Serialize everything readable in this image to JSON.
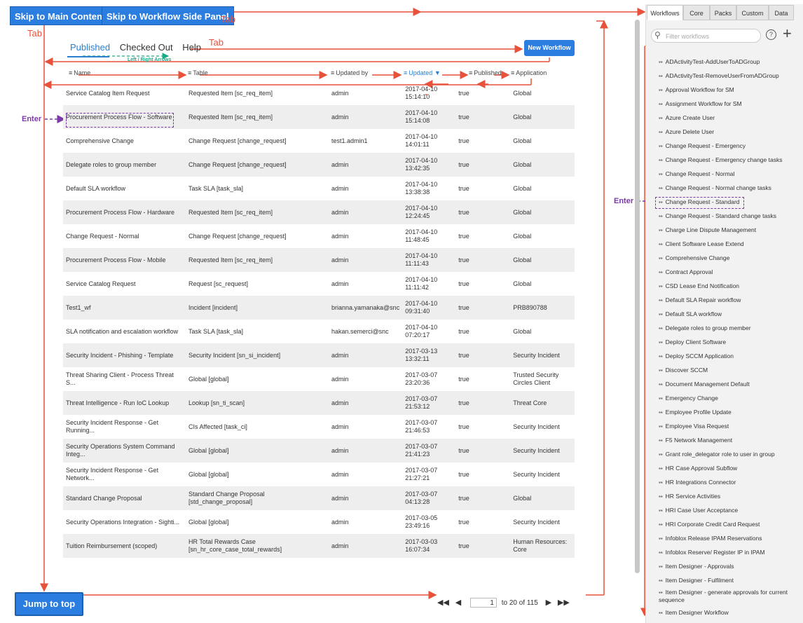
{
  "skip": {
    "main": "Skip to Main Content",
    "panel": "Skip to Workflow Side Panel"
  },
  "annotations": {
    "tab": "Tab",
    "enter": "Enter",
    "left_right": "Left / Right Arrows"
  },
  "tabs": {
    "published": "Published",
    "checked_out": "Checked Out",
    "help": "Help"
  },
  "new_workflow": "New Workflow",
  "columns": {
    "name": "Name",
    "table": "Table",
    "updated_by": "Updated by",
    "updated": "Updated",
    "published": "Published",
    "application": "Application"
  },
  "rows": [
    {
      "name": "Service Catalog Item Request",
      "table": "Requested Item [sc_req_item]",
      "by": "admin",
      "date": "2017-04-10",
      "time": "15:14:10",
      "pub": "true",
      "app": "Global"
    },
    {
      "name": "Procurement Process Flow - Software",
      "table": "Requested Item [sc_req_item]",
      "by": "admin",
      "date": "2017-04-10",
      "time": "15:14:08",
      "pub": "true",
      "app": "Global"
    },
    {
      "name": "Comprehensive Change",
      "table": "Change Request [change_request]",
      "by": "test1.admin1",
      "date": "2017-04-10",
      "time": "14:01:11",
      "pub": "true",
      "app": "Global"
    },
    {
      "name": "Delegate roles to group member",
      "table": "Change Request [change_request]",
      "by": "admin",
      "date": "2017-04-10",
      "time": "13:42:35",
      "pub": "true",
      "app": "Global"
    },
    {
      "name": "Default SLA workflow",
      "table": "Task SLA [task_sla]",
      "by": "admin",
      "date": "2017-04-10",
      "time": "13:38:38",
      "pub": "true",
      "app": "Global"
    },
    {
      "name": "Procurement Process Flow - Hardware",
      "table": "Requested Item [sc_req_item]",
      "by": "admin",
      "date": "2017-04-10",
      "time": "12:24:45",
      "pub": "true",
      "app": "Global"
    },
    {
      "name": "Change Request - Normal",
      "table": "Change Request [change_request]",
      "by": "admin",
      "date": "2017-04-10",
      "time": "11:48:45",
      "pub": "true",
      "app": "Global"
    },
    {
      "name": "Procurement Process Flow - Mobile",
      "table": "Requested Item [sc_req_item]",
      "by": "admin",
      "date": "2017-04-10",
      "time": "11:11:43",
      "pub": "true",
      "app": "Global"
    },
    {
      "name": "Service Catalog Request",
      "table": "Request [sc_request]",
      "by": "admin",
      "date": "2017-04-10",
      "time": "11:11:42",
      "pub": "true",
      "app": "Global"
    },
    {
      "name": "Test1_wf",
      "table": "Incident [incident]",
      "by": "brianna.yamanaka@snc",
      "date": "2017-04-10",
      "time": "09:31:40",
      "pub": "true",
      "app": "PRB890788"
    },
    {
      "name": "SLA notification and escalation workflow",
      "table": "Task SLA [task_sla]",
      "by": "hakan.semerci@snc",
      "date": "2017-04-10",
      "time": "07:20:17",
      "pub": "true",
      "app": "Global"
    },
    {
      "name": "Security Incident - Phishing - Template",
      "table": "Security Incident [sn_si_incident]",
      "by": "admin",
      "date": "2017-03-13",
      "time": "13:32:11",
      "pub": "true",
      "app": "Security Incident"
    },
    {
      "name": "Threat Sharing Client - Process Threat S...",
      "table": "Global [global]",
      "by": "admin",
      "date": "2017-03-07",
      "time": "23:20:36",
      "pub": "true",
      "app": "Trusted Security Circles Client"
    },
    {
      "name": "Threat Intelligence - Run IoC Lookup",
      "table": "Lookup [sn_ti_scan]",
      "by": "admin",
      "date": "2017-03-07",
      "time": "21:53:12",
      "pub": "true",
      "app": "Threat Core"
    },
    {
      "name": "Security Incident Response - Get Running...",
      "table": "CIs Affected [task_ci]",
      "by": "admin",
      "date": "2017-03-07",
      "time": "21:46:53",
      "pub": "true",
      "app": "Security Incident"
    },
    {
      "name": "Security Operations System Command Integ...",
      "table": "Global [global]",
      "by": "admin",
      "date": "2017-03-07",
      "time": "21:41:23",
      "pub": "true",
      "app": "Security Incident"
    },
    {
      "name": "Security Incident Response - Get Network...",
      "table": "Global [global]",
      "by": "admin",
      "date": "2017-03-07",
      "time": "21:27:21",
      "pub": "true",
      "app": "Security Incident"
    },
    {
      "name": "Standard Change Proposal",
      "table": "Standard Change Proposal [std_change_proposal]",
      "by": "admin",
      "date": "2017-03-07",
      "time": "04:13:28",
      "pub": "true",
      "app": "Global"
    },
    {
      "name": "Security Operations Integration - Sighti...",
      "table": "Global [global]",
      "by": "admin",
      "date": "2017-03-05",
      "time": "23:49:16",
      "pub": "true",
      "app": "Security Incident"
    },
    {
      "name": "Tuition Reimbursement (scoped)",
      "table": "HR Total Rewards Case [sn_hr_core_case_total_rewards]",
      "by": "admin",
      "date": "2017-03-03",
      "time": "16:07:34",
      "pub": "true",
      "app": "Human Resources: Core"
    }
  ],
  "pager": {
    "page": "1",
    "range": "to 20 of 115"
  },
  "jump_top": "Jump to top",
  "panel": {
    "tabs": [
      "Workflows",
      "Core",
      "Packs",
      "Custom",
      "Data"
    ],
    "filter_placeholder": "Filter workflows",
    "help": "?",
    "items": [
      "ADActivityTest-AddUserToADGroup",
      "ADActivityTest-RemoveUserFromADGroup",
      "Approval Workflow for SM",
      "Assignment Workflow for SM",
      "Azure Create User",
      "Azure Delete User",
      "Change Request - Emergency",
      "Change Request - Emergency change tasks",
      "Change Request - Normal",
      "Change Request - Normal change tasks",
      "Change Request - Standard",
      "Change Request - Standard change tasks",
      "Charge Line Dispute Management",
      "Client Software Lease Extend",
      "Comprehensive Change",
      "Contract Approval",
      "CSD Lease End Notification",
      "Default SLA Repair workflow",
      "Default SLA workflow",
      "Delegate roles to group member",
      "Deploy Client Software",
      "Deploy SCCM Application",
      "Discover SCCM",
      "Document Management Default",
      "Emergency Change",
      "Employee Profile Update",
      "Employee Visa Request",
      "F5 Network Management",
      "Grant role_delegator role to user in group",
      "HR Case Approval Subflow",
      "HR Integrations Connector",
      "HR Service Activities",
      "HRI Case User Acceptance",
      "HRI Corporate Credit Card Request",
      "Infoblox Release IPAM Reservations",
      "Infoblox Reserve/ Register IP in IPAM",
      "Item Designer - Approvals",
      "Item Designer - Fulfilment",
      "Item Designer - generate approvals for current sequence",
      "Item Designer Workflow"
    ]
  }
}
